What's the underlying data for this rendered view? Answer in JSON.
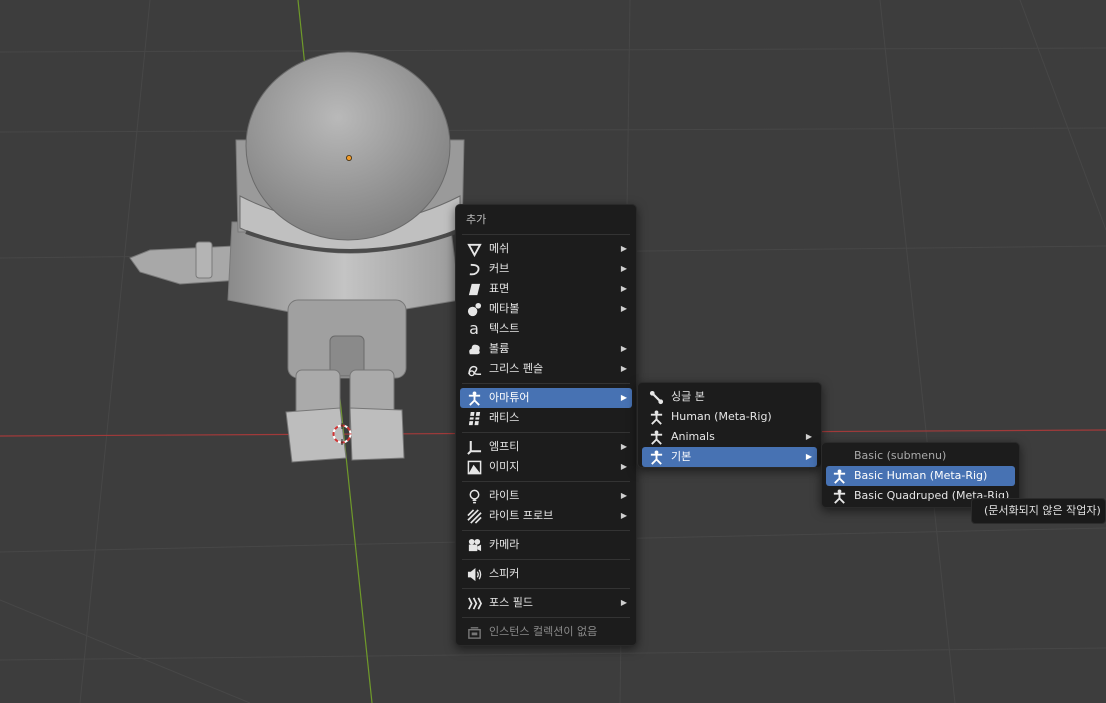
{
  "add_menu": {
    "title": "추가",
    "items": [
      {
        "label": "메쉬",
        "icon": "mesh-icon",
        "submenu": true
      },
      {
        "label": "커브",
        "icon": "curve-icon",
        "submenu": true
      },
      {
        "label": "표면",
        "icon": "surface-icon",
        "submenu": true
      },
      {
        "label": "메타볼",
        "icon": "metaball-icon",
        "submenu": true
      },
      {
        "label": "텍스트",
        "icon": "text-icon",
        "submenu": false
      },
      {
        "label": "볼륨",
        "icon": "volume-icon",
        "submenu": true
      },
      {
        "label": "그리스 펜슬",
        "icon": "grease-pencil-icon",
        "submenu": true
      },
      {
        "label": "아마튜어",
        "icon": "armature-icon",
        "submenu": true,
        "active": true
      },
      {
        "label": "래티스",
        "icon": "lattice-icon",
        "submenu": false
      },
      {
        "label": "엠프티",
        "icon": "empty-icon",
        "submenu": true
      },
      {
        "label": "이미지",
        "icon": "image-icon",
        "submenu": true
      },
      {
        "label": "라이트",
        "icon": "light-icon",
        "submenu": true
      },
      {
        "label": "라이트 프로브",
        "icon": "light-probe-icon",
        "submenu": true
      },
      {
        "label": "카메라",
        "icon": "camera-icon",
        "submenu": false
      },
      {
        "label": "스피커",
        "icon": "speaker-icon",
        "submenu": false
      },
      {
        "label": "포스 필드",
        "icon": "force-field-icon",
        "submenu": true
      },
      {
        "label": "인스턴스 컬렉션이 없음",
        "icon": "collection-instance-icon",
        "submenu": false,
        "disabled": true
      }
    ]
  },
  "armature_menu": {
    "items": [
      {
        "label": "싱글 본",
        "icon": "bone-icon",
        "submenu": false
      },
      {
        "label": "Human (Meta-Rig)",
        "icon": "armature-icon",
        "submenu": false
      },
      {
        "label": "Animals",
        "icon": "armature-icon",
        "submenu": true
      },
      {
        "label": "기본",
        "icon": "armature-icon",
        "submenu": true,
        "active": true
      }
    ]
  },
  "basic_menu": {
    "title": "Basic (submenu)",
    "items": [
      {
        "label": "Basic Human (Meta-Rig)",
        "icon": "armature-icon",
        "active": true
      },
      {
        "label": "Basic Quadruped (Meta-Rig)",
        "icon": "armature-icon"
      }
    ]
  },
  "tooltip": {
    "text": "(문서화되지 않은 작업자)"
  },
  "colors": {
    "background": "#3d3d3d",
    "menu_bg": "#1c1c1c",
    "highlight": "#4772b3",
    "x_axis": "#a13a3a",
    "y_axis": "#6f9a2a",
    "origin": "#f09a28"
  }
}
